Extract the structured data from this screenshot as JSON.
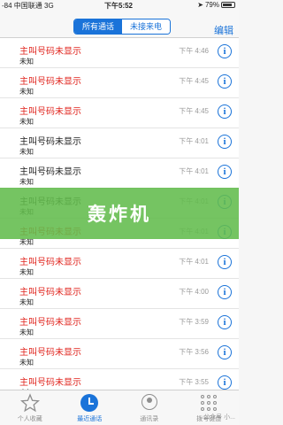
{
  "status_bar": {
    "carrier": "-84 中国联通",
    "network": "3G",
    "time": "下午5:52",
    "battery": "79%",
    "battery_level": 0.79
  },
  "nav": {
    "segments": [
      "所有通话",
      "未接来电"
    ],
    "active_segment": 0,
    "edit_label": "编辑"
  },
  "calls": [
    {
      "name": "主叫号码未显示",
      "sub": "未知",
      "time": "下午 4:46",
      "missed": true
    },
    {
      "name": "主叫号码未显示",
      "sub": "未知",
      "time": "下午 4:45",
      "missed": true
    },
    {
      "name": "主叫号码未显示",
      "sub": "未知",
      "time": "下午 4:45",
      "missed": true
    },
    {
      "name": "主叫号码未显示",
      "sub": "未知",
      "time": "下午 4:01",
      "missed": false
    },
    {
      "name": "主叫号码未显示",
      "sub": "未知",
      "time": "下午 4:01",
      "missed": false
    },
    {
      "name": "主叫号码未显示",
      "sub": "未知",
      "time": "下午 4:01",
      "missed": false
    },
    {
      "name": "主叫号码未显示",
      "sub": "未知",
      "time": "下午 4:01",
      "missed": true
    },
    {
      "name": "主叫号码未显示",
      "sub": "未知",
      "time": "下午 4:01",
      "missed": true
    },
    {
      "name": "主叫号码未显示",
      "sub": "未知",
      "time": "下午 4:00",
      "missed": true
    },
    {
      "name": "主叫号码未显示",
      "sub": "未知",
      "time": "下午 3:59",
      "missed": true
    },
    {
      "name": "主叫号码未显示",
      "sub": "未知",
      "time": "下午 3:56",
      "missed": true
    },
    {
      "name": "主叫号码未显示",
      "sub": "未知",
      "time": "下午 3:55",
      "missed": true
    }
  ],
  "overlay": {
    "title": "轰炸机",
    "color": "#62bc4c"
  },
  "tabbar": {
    "tabs": [
      {
        "label": "个人收藏",
        "icon": "star-icon"
      },
      {
        "label": "最近通话",
        "icon": "clock-icon"
      },
      {
        "label": "通讯录",
        "icon": "contacts-icon"
      },
      {
        "label": "拨号键盘",
        "icon": "keypad-icon"
      }
    ],
    "active_tab": 1,
    "watermark": "公众号 小..."
  },
  "colors": {
    "accent": "#1a73d9",
    "missed": "#e0231c"
  }
}
